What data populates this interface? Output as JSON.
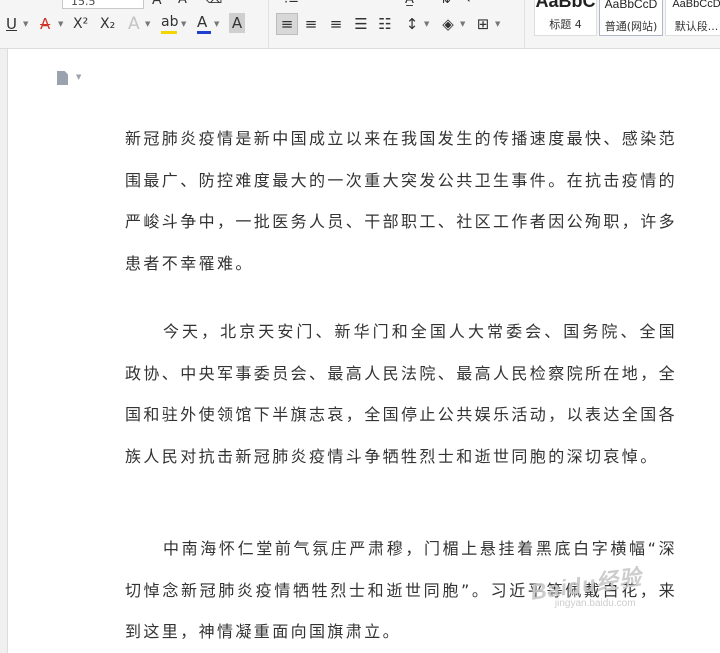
{
  "toolbar": {
    "font_size": "15.5",
    "buttons": {
      "underline": "U",
      "strikethrough": "A",
      "superscript": "X²",
      "subscript": "X₂",
      "text_effect": "A",
      "highlight": "ab",
      "font_color": "A",
      "char_shading": "A"
    },
    "colors": {
      "font_color_bar": "#1f3fcf",
      "highlight_bar": "#f5d500",
      "strike_red": "#d0342c"
    },
    "styles": [
      {
        "sample": "AaBbC",
        "name": "标题 4"
      },
      {
        "sample": "AaBbCcD",
        "name": "普通(网站)"
      },
      {
        "sample": "AaBbCcD",
        "name": "默认段..."
      }
    ]
  },
  "document": {
    "paragraphs": [
      "新冠肺炎疫情是新中国成立以来在我国发生的传播速度最快、感染范围最广、防控难度最大的一次重大突发公共卫生事件。在抗击疫情的严峻斗争中，一批医务人员、干部职工、社区工作者因公殉职，许多患者不幸罹难。",
      "今天，北京天安门、新华门和全国人大常委会、国务院、全国政协、中央军事委员会、最高人民法院、最高人民检察院所在地，全国和驻外使领馆下半旗志哀，全国停止公共娱乐活动，以表达全国各族人民对抗击新冠肺炎疫情斗争牺牲烈士和逝世同胞的深切哀悼。",
      "中南海怀仁堂前气氛庄严肃穆，门楣上悬挂着黑底白字横幅“深切悼念新冠肺炎疫情牺牲烈士和逝世同胞”。习近平等佩戴白花，来到这里，神情凝重面向国旗肃立。"
    ]
  },
  "watermark": {
    "main": "Baidu经验",
    "sub": "jingyan.baidu.com"
  }
}
